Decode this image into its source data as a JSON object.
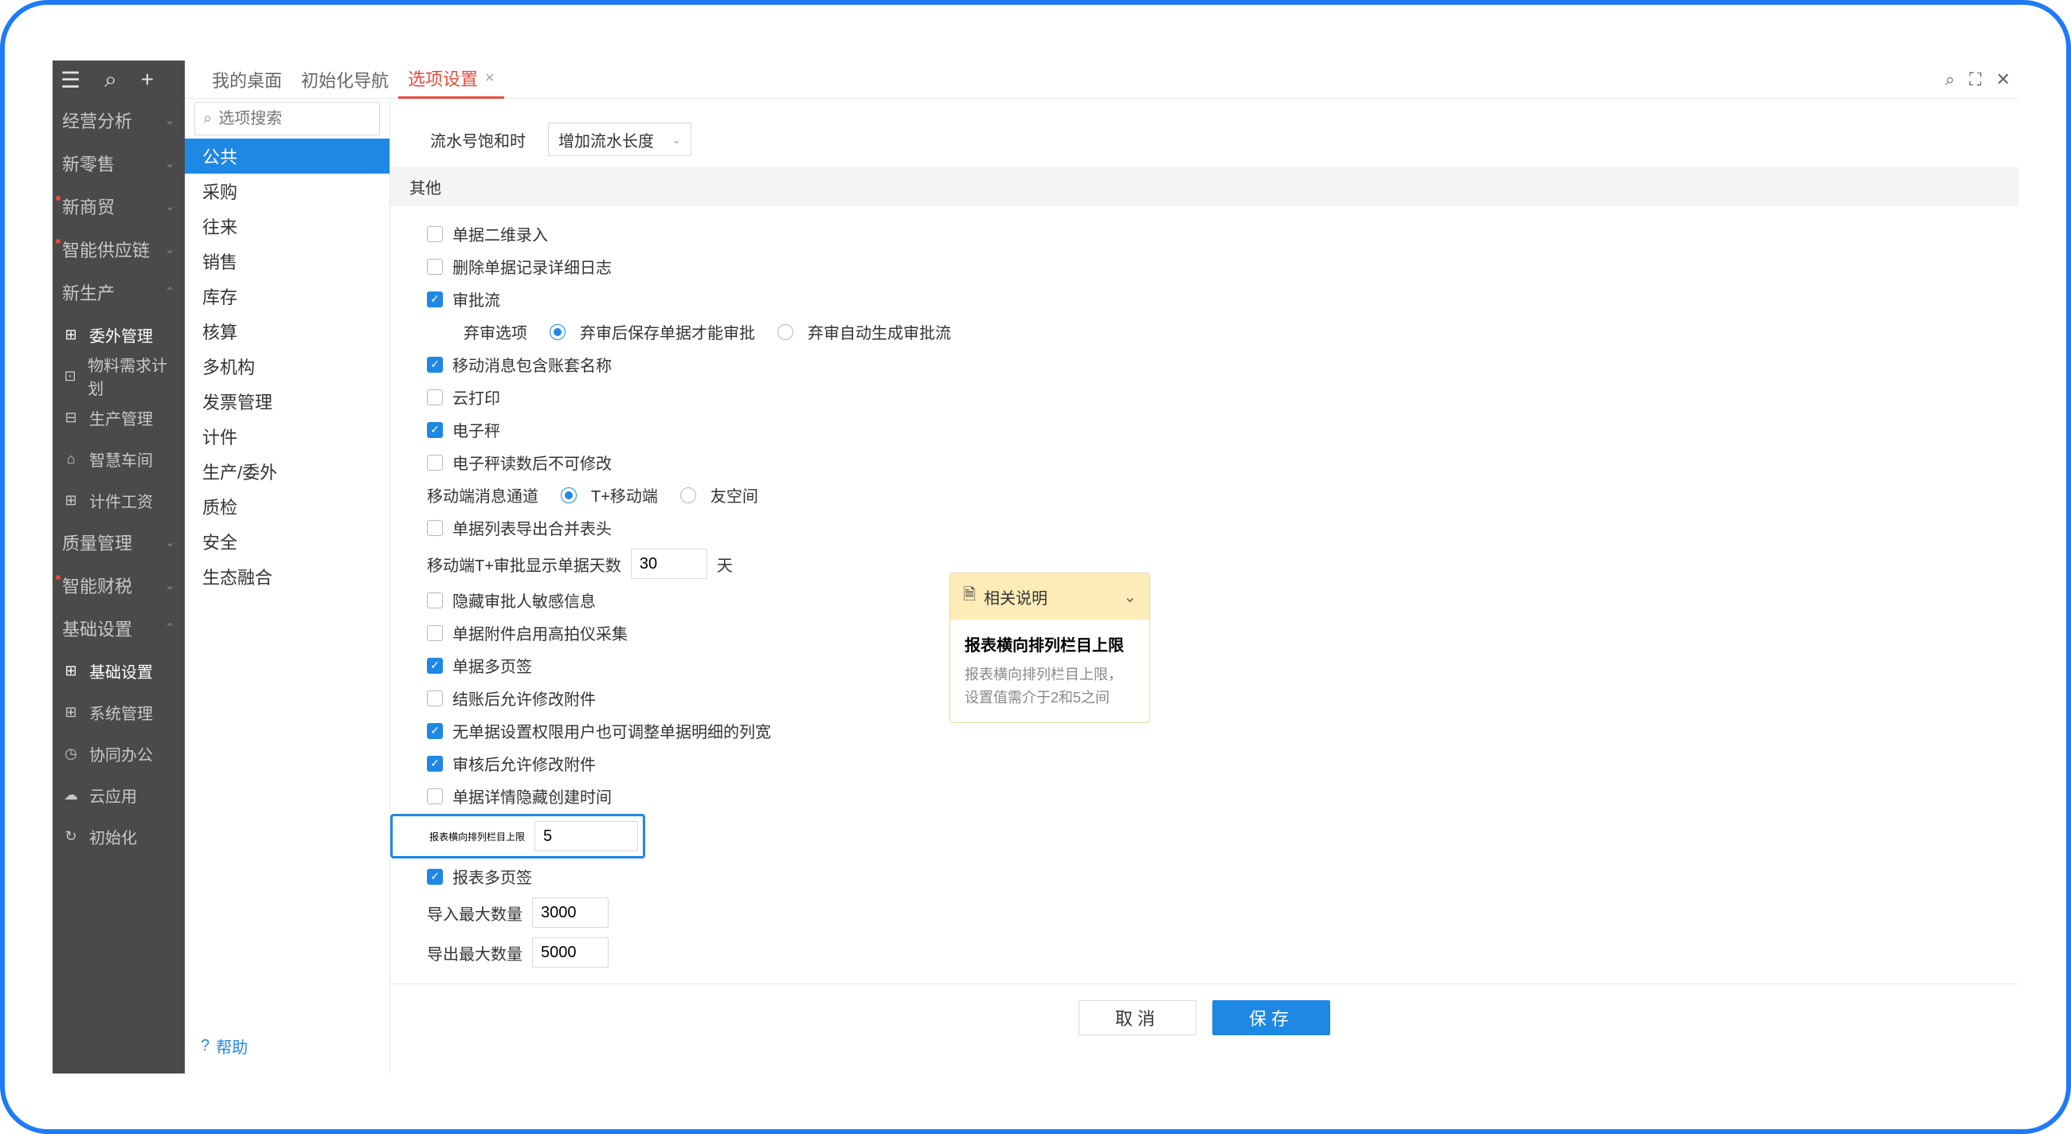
{
  "tabs": [
    {
      "label": "我的桌面",
      "active": false
    },
    {
      "label": "初始化导航",
      "active": false
    },
    {
      "label": "选项设置",
      "active": true
    }
  ],
  "sidebar": {
    "groups": [
      {
        "label": "经营分析",
        "expandable": true,
        "dot": false
      },
      {
        "label": "新零售",
        "expandable": true,
        "dot": false
      },
      {
        "label": "新商贸",
        "expandable": true,
        "dot": true
      },
      {
        "label": "智能供应链",
        "expandable": true,
        "dot": true
      },
      {
        "label": "新生产",
        "expandable": true,
        "dot": false,
        "children": [
          {
            "label": "委外管理",
            "icon": "⊞",
            "active": true
          },
          {
            "label": "物料需求计划",
            "icon": "⊡"
          },
          {
            "label": "生产管理",
            "icon": "⊟"
          },
          {
            "label": "智慧车间",
            "icon": "⌂"
          },
          {
            "label": "计件工资",
            "icon": "⊞"
          }
        ]
      },
      {
        "label": "质量管理",
        "expandable": true,
        "dot": false
      },
      {
        "label": "智能财税",
        "expandable": true,
        "dot": true
      },
      {
        "label": "基础设置",
        "expandable": true,
        "dot": false,
        "children": [
          {
            "label": "基础设置",
            "icon": "⊞",
            "active": true
          },
          {
            "label": "系统管理",
            "icon": "⊞"
          },
          {
            "label": "协同办公",
            "icon": "◷"
          },
          {
            "label": "云应用",
            "icon": "☁"
          },
          {
            "label": "初始化",
            "icon": "↻"
          }
        ]
      }
    ]
  },
  "secondNav": {
    "searchPlaceholder": "选项搜索",
    "items": [
      {
        "label": "公共",
        "active": true
      },
      {
        "label": "采购"
      },
      {
        "label": "往来"
      },
      {
        "label": "销售"
      },
      {
        "label": "库存"
      },
      {
        "label": "核算"
      },
      {
        "label": "多机构"
      },
      {
        "label": "发票管理"
      },
      {
        "label": "计件"
      },
      {
        "label": "生产/委外"
      },
      {
        "label": "质检"
      },
      {
        "label": "安全"
      },
      {
        "label": "生态融合"
      }
    ],
    "helpLabel": "帮助"
  },
  "content": {
    "topRow": {
      "label": "流水号饱和时",
      "selectValue": "增加流水长度"
    },
    "sectionTitle": "其他",
    "options": {
      "opt1": {
        "label": "单据二维录入",
        "checked": false
      },
      "opt2": {
        "label": "删除单据记录详细日志",
        "checked": false
      },
      "opt3": {
        "label": "审批流",
        "checked": true
      },
      "opt3sub": {
        "label": "弃审选项",
        "radio1": "弃审后保存单据才能审批",
        "radio2": "弃审自动生成审批流",
        "selected": 1
      },
      "opt4": {
        "label": "移动消息包含账套名称",
        "checked": true
      },
      "opt5": {
        "label": "云打印",
        "checked": false
      },
      "opt6": {
        "label": "电子秤",
        "checked": true
      },
      "opt7": {
        "label": "电子秤读数后不可修改",
        "checked": false
      },
      "opt8": {
        "label": "移动端消息通道",
        "radio1": "T+移动端",
        "radio2": "友空间",
        "selected": 1
      },
      "opt9": {
        "label": "单据列表导出合并表头",
        "checked": false
      },
      "opt10": {
        "label": "移动端T+审批显示单据天数",
        "value": "30",
        "suffix": "天"
      },
      "opt11": {
        "label": "隐藏审批人敏感信息",
        "checked": false
      },
      "opt12": {
        "label": "单据附件启用高拍仪采集",
        "checked": false
      },
      "opt13": {
        "label": "单据多页签",
        "checked": true
      },
      "opt14": {
        "label": "结账后允许修改附件",
        "checked": false
      },
      "opt15": {
        "label": "无单据设置权限用户也可调整单据明细的列宽",
        "checked": true
      },
      "opt16": {
        "label": "审核后允许修改附件",
        "checked": true
      },
      "opt17": {
        "label": "单据详情隐藏创建时间",
        "checked": false
      },
      "opt18": {
        "label": "报表横向排列栏目上限",
        "value": "5"
      },
      "opt19": {
        "label": "报表多页签",
        "checked": true
      },
      "opt20": {
        "label": "导入最大数量",
        "value": "3000"
      },
      "opt21": {
        "label": "导出最大数量",
        "value": "5000"
      }
    }
  },
  "tooltip": {
    "headLabel": "相关说明",
    "title": "报表横向排列栏目上限",
    "text": "报表横向排列栏目上限，设置值需介于2和5之间"
  },
  "footer": {
    "cancel": "取消",
    "save": "保存"
  }
}
